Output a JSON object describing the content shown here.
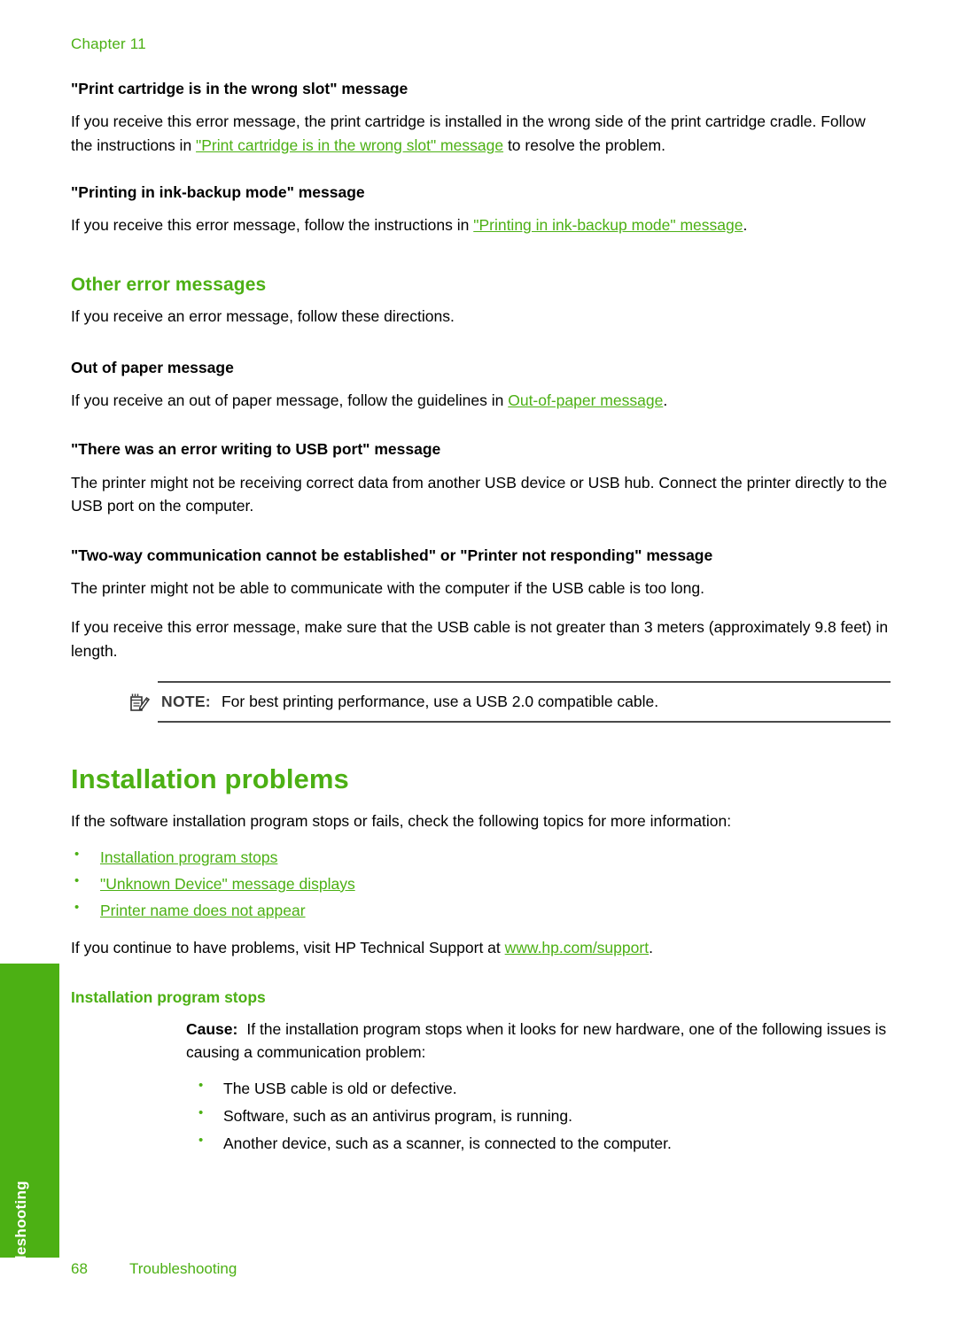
{
  "page": {
    "chapter_header": "Chapter 11",
    "footer_page_number": "68",
    "footer_label": "Troubleshooting",
    "side_tab_label": "Troubleshooting",
    "accent_green": "#4CB014",
    "text_black": "#000000",
    "note_rule_color": "#4a4a4a"
  },
  "sections": {
    "wrong_slot": {
      "heading": "\"Print cartridge is in the wrong slot\" message",
      "body_part1": "If you receive this error message, the print cartridge is installed in the wrong side of the print cartridge cradle. Follow the instructions in ",
      "link": "\"Print cartridge is in the wrong slot\" message",
      "body_part2": " to resolve the problem."
    },
    "ink_backup": {
      "heading": "\"Printing in ink-backup mode\" message",
      "body_part1": "If you receive this error message, follow the instructions in ",
      "link": "\"Printing in ink-backup mode\" message",
      "body_part2": "."
    },
    "other_error_messages": {
      "heading": "Other error messages",
      "intro": "If you receive an error message, follow these directions."
    },
    "out_of_paper": {
      "heading": "Out of paper message",
      "body_part1": "If you receive an out of paper message, follow the guidelines in ",
      "link": "Out-of-paper message",
      "body_part2": "."
    },
    "usb_port_error": {
      "heading": "\"There was an error writing to USB port\" message",
      "body": "The printer might not be receiving correct data from another USB device or USB hub. Connect the printer directly to the USB port on the computer."
    },
    "two_way": {
      "heading": "\"Two-way communication cannot be established\" or \"Printer not responding\" message",
      "body1": "The printer might not be able to communicate with the computer if the USB cable is too long.",
      "body2": "If you receive this error message, make sure that the USB cable is not greater than 3 meters (approximately 9.8 feet) in length."
    },
    "note": {
      "icon": "note-pencil-icon",
      "label": "NOTE:",
      "text": "For best printing performance, use a USB 2.0 compatible cable."
    },
    "installation_problems": {
      "heading": "Installation problems",
      "intro": "If the software installation program stops or fails, check the following topics for more information:",
      "links": [
        "Installation program stops",
        "\"Unknown Device\" message displays",
        "Printer name does not appear"
      ],
      "support_part1": "If you continue to have problems, visit HP Technical Support at ",
      "support_link": "www.hp.com/support",
      "support_part2": "."
    },
    "installation_program_stops": {
      "heading": "Installation program stops",
      "cause_label": "Cause:",
      "cause_text": "If the installation program stops when it looks for new hardware, one of the following issues is causing a communication problem:",
      "items": [
        "The USB cable is old or defective.",
        "Software, such as an antivirus program, is running.",
        "Another device, such as a scanner, is connected to the computer."
      ]
    }
  }
}
